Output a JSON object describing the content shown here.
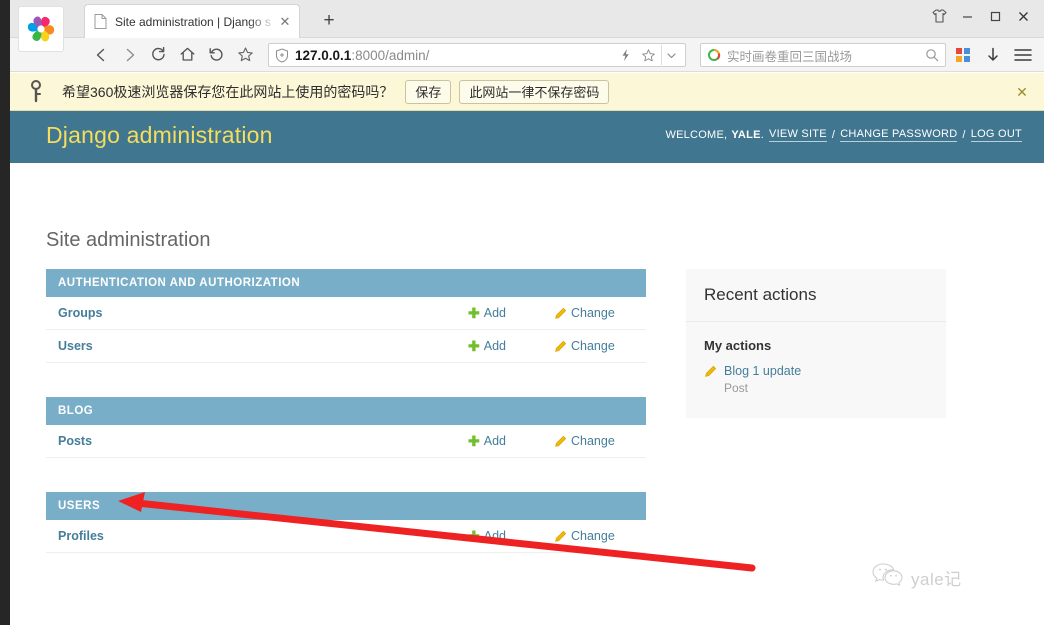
{
  "browser": {
    "logo_icon": "360-speed-browser-logo",
    "tab": {
      "favicon_icon": "page-icon",
      "title": "Site administration | Django s",
      "close_icon": "close-icon"
    },
    "new_tab_label": "+",
    "window_controls": [
      {
        "name": "shirt-skin-icon",
        "glyph": "shirt"
      },
      {
        "name": "minimize-button",
        "glyph": "minimize"
      },
      {
        "name": "maximize-button",
        "glyph": "maximize"
      },
      {
        "name": "close-window-button",
        "glyph": "close"
      }
    ],
    "nav_icons": [
      {
        "name": "back-button",
        "glyph": "chevron-left"
      },
      {
        "name": "forward-button",
        "glyph": "chevron-right"
      },
      {
        "name": "reload-button",
        "glyph": "reload"
      },
      {
        "name": "home-button",
        "glyph": "home"
      },
      {
        "name": "restore-button",
        "glyph": "undo-arrow"
      },
      {
        "name": "bookmark-star-button",
        "glyph": "star"
      }
    ],
    "address": {
      "shield_icon": "shield-icon",
      "host": "127.0.0.1",
      "path": ":8000/admin/",
      "lightning_icon": "lightning-icon",
      "star_icon": "star-icon",
      "chevron_icon": "chevron-down-icon"
    },
    "search": {
      "engine_icon": "360-search-logo",
      "placeholder": "实时画卷重回三国战场",
      "search_icon": "search-icon"
    },
    "right_tools": [
      {
        "name": "apps-grid-icon",
        "glyph": "grid"
      },
      {
        "name": "downloads-icon",
        "glyph": "download-arrow"
      },
      {
        "name": "menu-icon",
        "glyph": "hamburger"
      }
    ]
  },
  "notification": {
    "key_icon": "key-icon",
    "message": "希望360极速浏览器保存您在此网站上使用的密码吗？",
    "save_label": "保存",
    "never_label": "此网站一律不保存密码",
    "close_icon": "close-icon"
  },
  "django": {
    "brand": "Django administration",
    "welcome_prefix": "WELCOME,",
    "username": "YALE",
    "welcome_suffix": ".",
    "links": {
      "view_site": "VIEW SITE",
      "change_password": "CHANGE PASSWORD",
      "log_out": "LOG OUT"
    },
    "separator": "/",
    "page_title": "Site administration",
    "add_label": "Add",
    "change_label": "Change",
    "add_icon": "plus-icon",
    "change_icon": "pencil-icon",
    "modules": [
      {
        "caption": "AUTHENTICATION AND AUTHORIZATION",
        "models": [
          {
            "name": "Groups"
          },
          {
            "name": "Users"
          }
        ]
      },
      {
        "caption": "BLOG",
        "models": [
          {
            "name": "Posts"
          }
        ]
      },
      {
        "caption": "USERS",
        "models": [
          {
            "name": "Profiles"
          }
        ]
      }
    ],
    "sidebar": {
      "heading": "Recent actions",
      "subheading": "My actions",
      "actions": [
        {
          "icon": "pencil-icon",
          "label": "Blog 1 update",
          "type": "Post"
        }
      ]
    }
  },
  "annotation": {
    "arrow_color": "#ee2222",
    "arrow_name": "red-annotation-arrow"
  },
  "watermark": {
    "icon": "wechat-icon",
    "text": "yale记"
  },
  "colors": {
    "django_header": "#417690",
    "module_header": "#79aec8",
    "brand_yellow": "#f5dd5d",
    "link_blue": "#447e9b",
    "add_green": "#70bf2b",
    "pencil_yellow": "#efb80b",
    "notif_bg": "#fcf7d6"
  }
}
